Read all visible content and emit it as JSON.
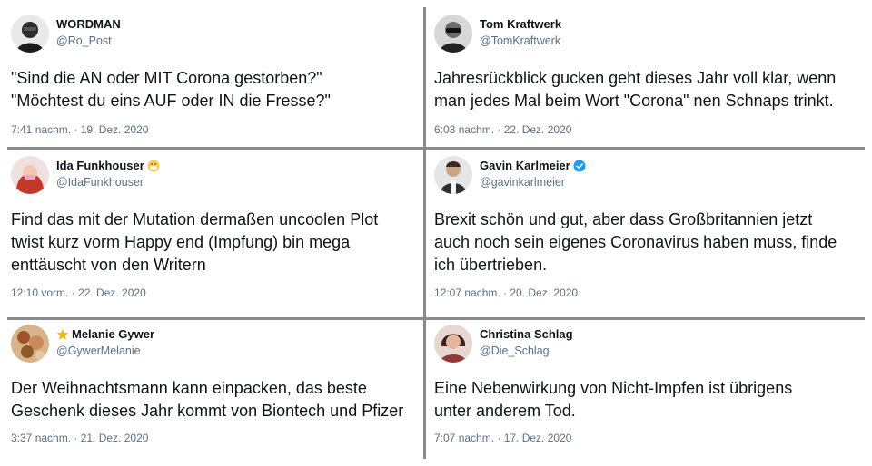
{
  "tweets": [
    {
      "name": "WORDMAN",
      "handle": "@Ro_Post",
      "lines": [
        "\"Sind die AN oder MIT Corona gestorben?\"",
        "\"Möchtest du eins AUF oder IN die Fresse?\""
      ],
      "date": "7:41 nachm. · 19. Dez. 2020",
      "avatar_color": "#2a2a2a",
      "badge": ""
    },
    {
      "name": "Tom Kraftwerk",
      "handle": "@TomKraftwerk",
      "lines": [
        "Jahresrückblick gucken geht dieses Jahr voll klar, wenn",
        "man jedes Mal beim Wort \"Corona\" nen Schnaps trinkt."
      ],
      "date": "6:03 nachm. · 22. Dez. 2020",
      "avatar_color": "#3b3b3b",
      "badge": ""
    },
    {
      "name": "Ida Funkhouser",
      "handle": "@IdaFunkhouser",
      "lines": [
        "Find das mit der Mutation dermaßen uncoolen Plot",
        "twist kurz vorm Happy end (Impfung) bin mega",
        "enttäuscht von den Writern"
      ],
      "date": "12:10 vorm. · 22. Dez. 2020",
      "avatar_color": "#c0392b",
      "badge": "mask-emoji-icon"
    },
    {
      "name": "Gavin Karlmeier",
      "handle": "@gavinkarlmeier",
      "lines": [
        "Brexit schön und gut, aber dass Großbritannien jetzt",
        "auch noch sein eigenes Coronavirus haben muss, finde",
        "ich übertrieben."
      ],
      "date": "12:07 nachm. · 20. Dez. 2020",
      "avatar_color": "#4a4a4a",
      "badge": "verified-icon"
    },
    {
      "name": "Melanie Gywer",
      "handle": "@GywerMelanie",
      "lines": [
        "Der Weihnachtsmann kann einpacken, das beste",
        "Geschenk dieses Jahr kommt von Biontech und Pfizer"
      ],
      "date": "3:37 nachm. · 21. Dez. 2020",
      "avatar_color": "#b07a4a",
      "badge": "star-icon"
    },
    {
      "name": "Christina Schlag",
      "handle": "@Die_Schlag",
      "lines": [
        "Eine Nebenwirkung von Nicht-Impfen ist übrigens",
        "unter anderem Tod."
      ],
      "date": "7:07 nachm. · 17. Dez. 2020",
      "avatar_color": "#8e3b3b",
      "badge": ""
    }
  ]
}
